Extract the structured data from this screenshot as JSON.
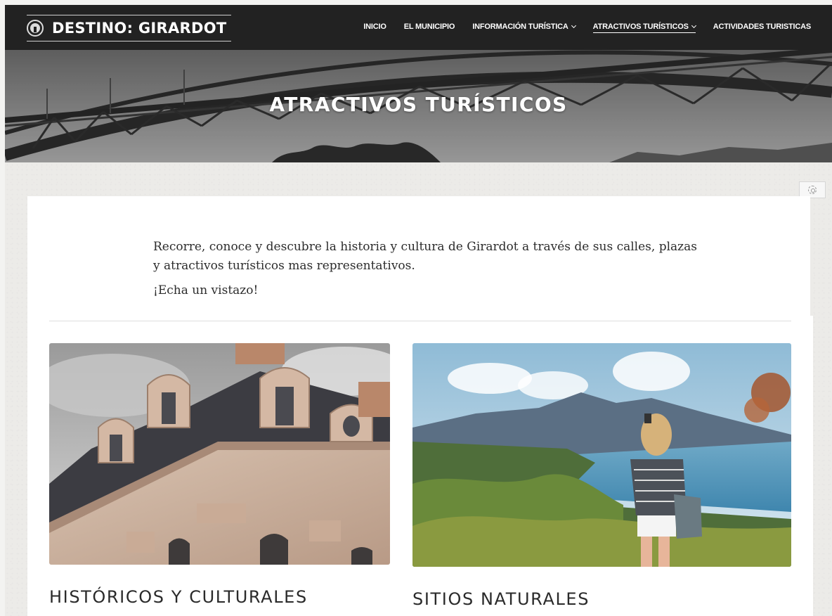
{
  "header": {
    "logo_text": "DESTINO: GIRARDOT",
    "menu": [
      {
        "label": "INICIO",
        "has_dropdown": false,
        "active": false
      },
      {
        "label": "EL MUNICIPIO",
        "has_dropdown": false,
        "active": false
      },
      {
        "label": "INFORMACIÓN TURÍSTICA",
        "has_dropdown": true,
        "active": false
      },
      {
        "label": "ATRACTIVOS TURÍSTICOS",
        "has_dropdown": true,
        "active": true
      },
      {
        "label": "ACTIVIDADES TURISTICAS",
        "has_dropdown": false,
        "active": false
      }
    ]
  },
  "hero": {
    "title": "ATRACTIVOS TURÍSTICOS",
    "image": "bridge-photo"
  },
  "intro": {
    "paragraph1": "Recorre, conoce y descubre la historia y cultura de Girardot a través de sus calles, plazas y atractivos turísticos mas representativos.",
    "paragraph2": "¡Echa un vistazo!"
  },
  "categories": [
    {
      "title": "HISTÓRICOS Y CULTURALES",
      "image": "historic-building-photo"
    },
    {
      "title": "SITIOS NATURALES",
      "image": "nature-landscape-photo"
    }
  ],
  "icons": {
    "settings": "gear-icon"
  },
  "colors": {
    "navbar": "#222222",
    "text": "#2a2a2a"
  }
}
